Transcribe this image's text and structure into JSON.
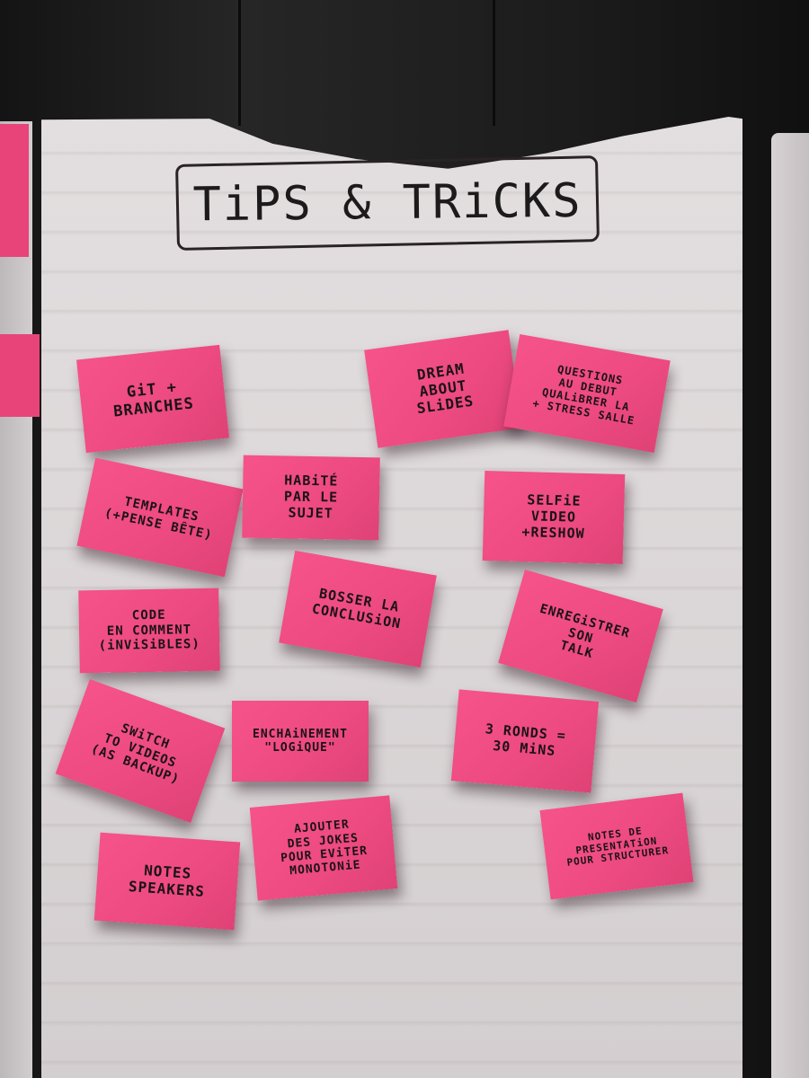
{
  "board": {
    "title": "TiPS & TRiCKS"
  },
  "notes": [
    {
      "text": "GiT +\nBRANCHES"
    },
    {
      "text": "DREAM\nABOUT\nSLiDES"
    },
    {
      "text": "QUESTIONS\nAU DEBUT\nQUALiBRER LA\n+ STRESS SALLE"
    },
    {
      "text": "TEMPLATES\n(+PENSE BÊTE)"
    },
    {
      "text": "HABiTÉ\nPAR LE\nSUJET"
    },
    {
      "text": "SELFiE\nVIDEO\n+RESHOW"
    },
    {
      "text": "CODE\nEN COMMENT\n(iNViSiBLES)"
    },
    {
      "text": "BOSSER LA\nCONCLUSiON"
    },
    {
      "text": "ENREGiSTRER\nSON\nTALK"
    },
    {
      "text": "SWiTCH\nTO VIDEOS\n(AS BACKUP)"
    },
    {
      "text": "ENCHAiNEMENT\n\"LOGiQUE\""
    },
    {
      "text": "3 RONDS =\n30 MiNS"
    },
    {
      "text": "NOTES\nSPEAKERS"
    },
    {
      "text": "AJOUTER\nDES JOKES\nPOUR EViTER\nMONOTONiE"
    },
    {
      "text": "NOTES DE\nPRESENTATiON\nPOUR STRUCTURER"
    }
  ]
}
